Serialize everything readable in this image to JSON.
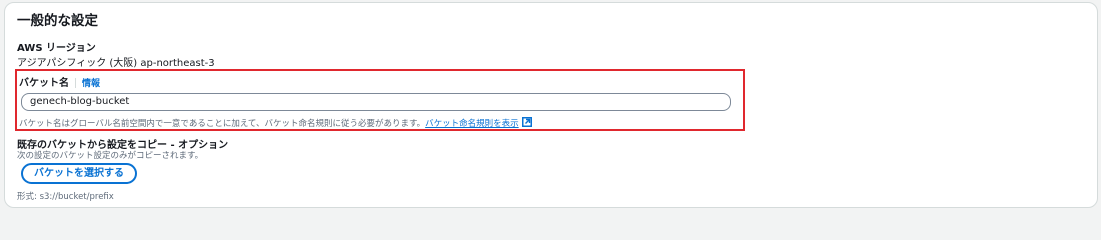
{
  "panel": {
    "title": "一般的な設定"
  },
  "region": {
    "label": "AWS リージョン",
    "value": "アジアパシフィック (大阪) ap-northeast-3"
  },
  "bucket_name": {
    "label": "バケット名",
    "info_link": "情報",
    "value": "genech-blog-bucket",
    "help_text": "バケット名はグローバル名前空間内で一意であることに加えて、バケット命名規則に従う必要があります。",
    "help_link": "バケット命名規則を表示",
    "highlight_color": "#e0282e"
  },
  "copy_settings": {
    "label": "既存のバケットから設定をコピー - オプション",
    "description": "次の設定のバケット設定のみがコピーされます。",
    "button_label": "バケットを選択する",
    "format_hint": "形式: s3://bucket/prefix"
  },
  "colors": {
    "accent": "#0972d3",
    "text": "#16191f",
    "muted": "#5f6b7a"
  }
}
